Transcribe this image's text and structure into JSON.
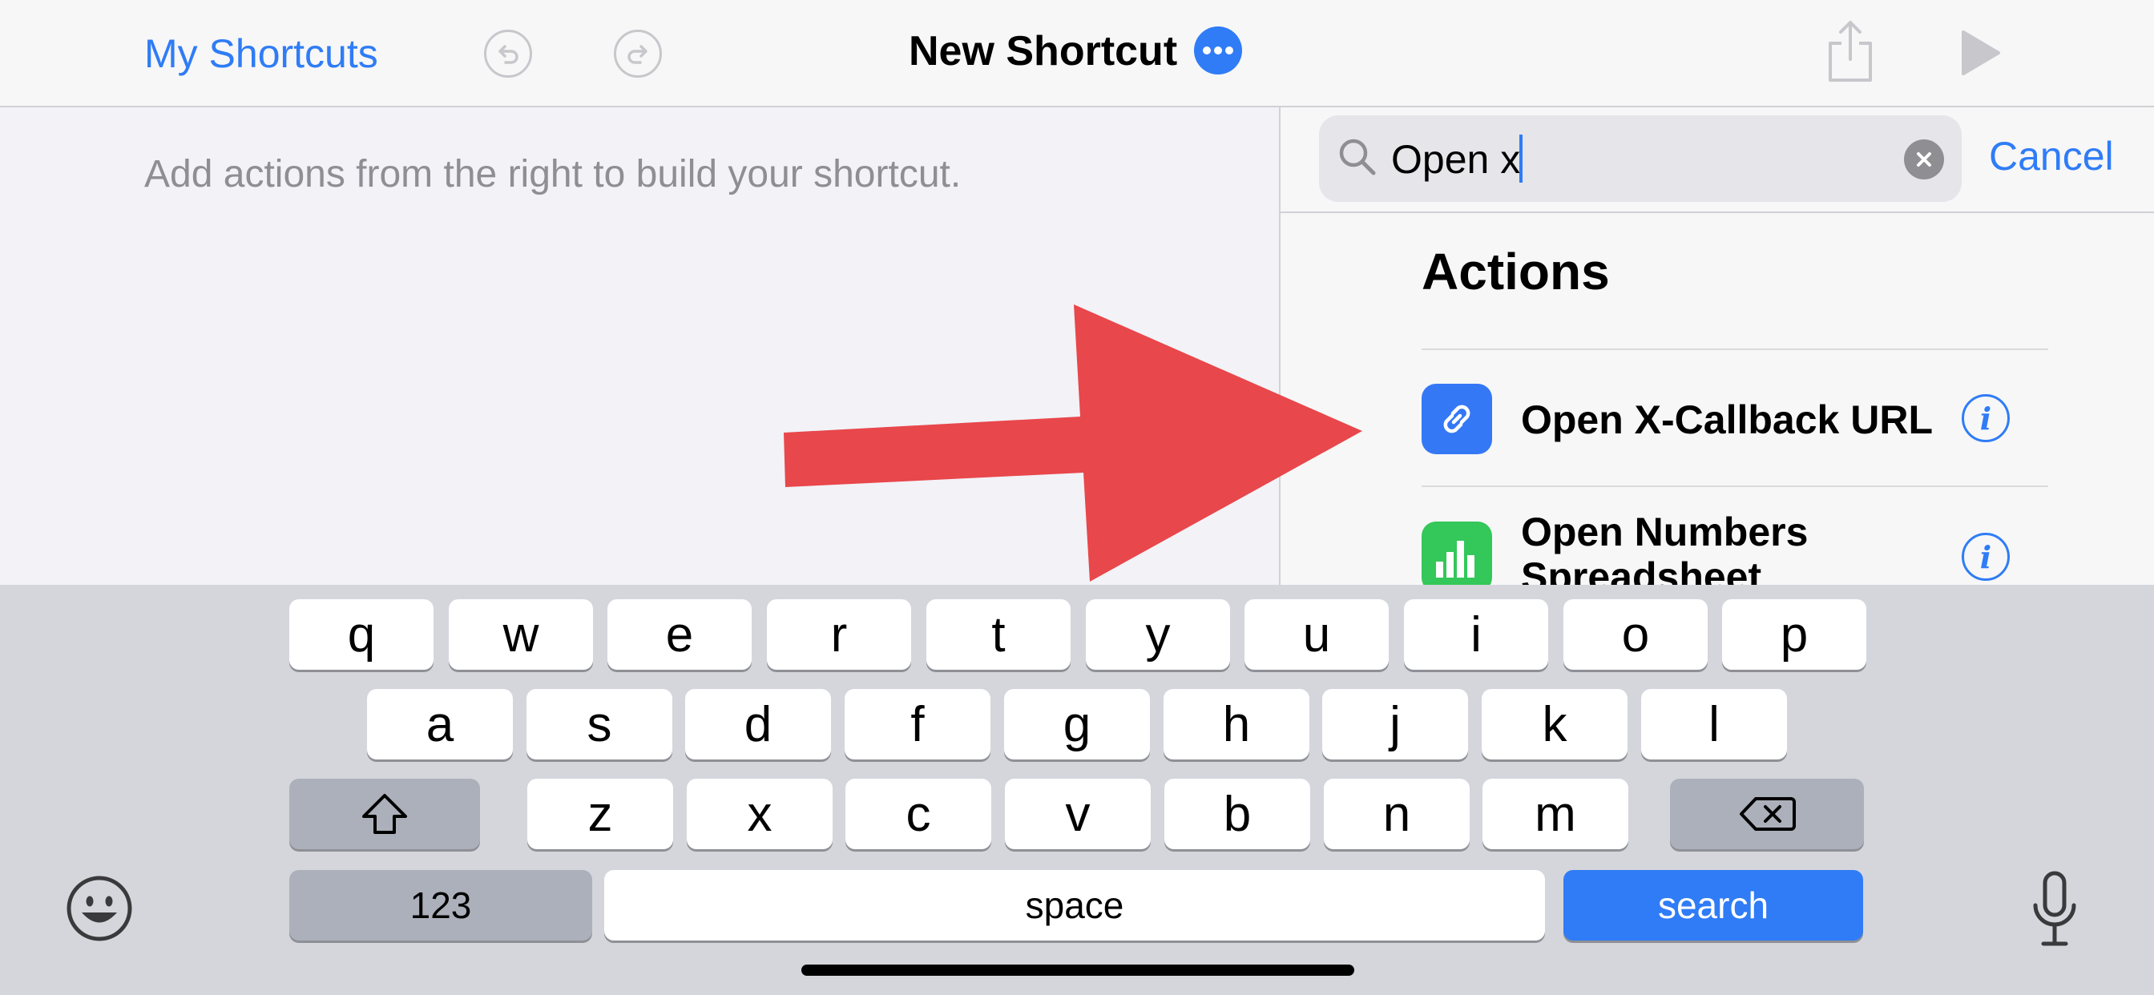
{
  "nav": {
    "back_label": "My Shortcuts",
    "title": "New Shortcut"
  },
  "editor": {
    "hint": "Add actions from the right to build your shortcut."
  },
  "search": {
    "value": "Open x",
    "cancel_label": "Cancel"
  },
  "results": {
    "heading": "Actions",
    "items": [
      {
        "label": "Open X-Callback URL",
        "icon": "link-icon",
        "icon_color": "#3478f6"
      },
      {
        "label": "Open Numbers Spreadsheet",
        "icon": "numbers-app-icon",
        "icon_color": "#34c759"
      }
    ]
  },
  "annotation": {
    "arrow_color": "#e8474b"
  },
  "keyboard": {
    "row1": [
      "q",
      "w",
      "e",
      "r",
      "t",
      "y",
      "u",
      "i",
      "o",
      "p"
    ],
    "row2": [
      "a",
      "s",
      "d",
      "f",
      "g",
      "h",
      "j",
      "k",
      "l"
    ],
    "row3": [
      "z",
      "x",
      "c",
      "v",
      "b",
      "n",
      "m"
    ],
    "numbers_label": "123",
    "space_label": "space",
    "search_label": "search"
  },
  "colors": {
    "accent": "#2f7cf6",
    "keyboard_bg": "#d4d6dc"
  }
}
